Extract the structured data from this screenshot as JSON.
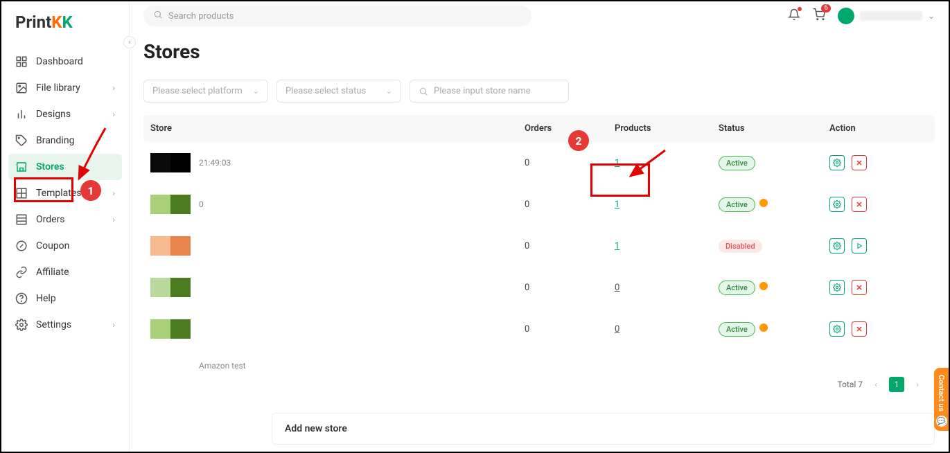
{
  "brand": {
    "text": "Print",
    "k1": "K",
    "k2": "K"
  },
  "search": {
    "placeholder": "Search products"
  },
  "cart": {
    "count": "6"
  },
  "sidebar": {
    "items": [
      {
        "label": "Dashboard",
        "icon": "dashboard"
      },
      {
        "label": "File library",
        "icon": "image",
        "chev": true
      },
      {
        "label": "Designs",
        "icon": "chart",
        "chev": true
      },
      {
        "label": "Branding",
        "icon": "tag"
      },
      {
        "label": "Stores",
        "icon": "store",
        "active": true
      },
      {
        "label": "Templates",
        "icon": "grid",
        "chev": true
      },
      {
        "label": "Orders",
        "icon": "list",
        "chev": true
      },
      {
        "label": "Coupon",
        "icon": "coupon"
      },
      {
        "label": "Affiliate",
        "icon": "link"
      },
      {
        "label": "Help",
        "icon": "help"
      },
      {
        "label": "Settings",
        "icon": "gear",
        "chev": true
      }
    ]
  },
  "page": {
    "title": "Stores"
  },
  "filters": {
    "platform": "Please select platform",
    "status": "Please select status",
    "name": "Please input store name"
  },
  "table": {
    "headers": {
      "store": "Store",
      "orders": "Orders",
      "products": "Products",
      "status": "Status",
      "action": "Action"
    },
    "rows": [
      {
        "thumb": [
          "t-black1",
          "t-black2"
        ],
        "meta": "21:49:03",
        "orders": "0",
        "products": "1",
        "status": "Active",
        "statusType": "active",
        "warn": false,
        "actions": [
          "gear",
          "close"
        ]
      },
      {
        "thumb": [
          "t-g1",
          "t-g2"
        ],
        "meta": "0",
        "orders": "0",
        "products": "1",
        "status": "Active",
        "statusType": "active",
        "warn": true,
        "actions": [
          "gear",
          "close"
        ]
      },
      {
        "thumb": [
          "t-o1",
          "t-o2"
        ],
        "meta": "",
        "orders": "0",
        "products": "1",
        "status": "Disabled",
        "statusType": "disabled",
        "warn": false,
        "actions": [
          "gear",
          "play"
        ]
      },
      {
        "thumb": [
          "t-g3",
          "t-g4"
        ],
        "meta": "",
        "orders": "0",
        "products": "0",
        "prodUnderline": true,
        "status": "Active",
        "statusType": "active",
        "warn": true,
        "actions": [
          "gear",
          "close"
        ]
      },
      {
        "thumb": [
          "t-g1",
          "t-g2"
        ],
        "meta": "",
        "orders": "0",
        "products": "0",
        "prodUnderline": true,
        "status": "Active",
        "statusType": "active",
        "warn": true,
        "actions": [
          "gear",
          "close"
        ]
      },
      {
        "thumb": [],
        "meta": "",
        "name": "Amazon test",
        "orders": "",
        "products": "",
        "status": "",
        "actions": []
      }
    ]
  },
  "pagination": {
    "total": "Total 7",
    "current": "1"
  },
  "addStore": {
    "label": "Add new store"
  },
  "contact": {
    "label": "Contact us"
  },
  "annotations": {
    "bubble1": "1",
    "bubble2": "2"
  }
}
